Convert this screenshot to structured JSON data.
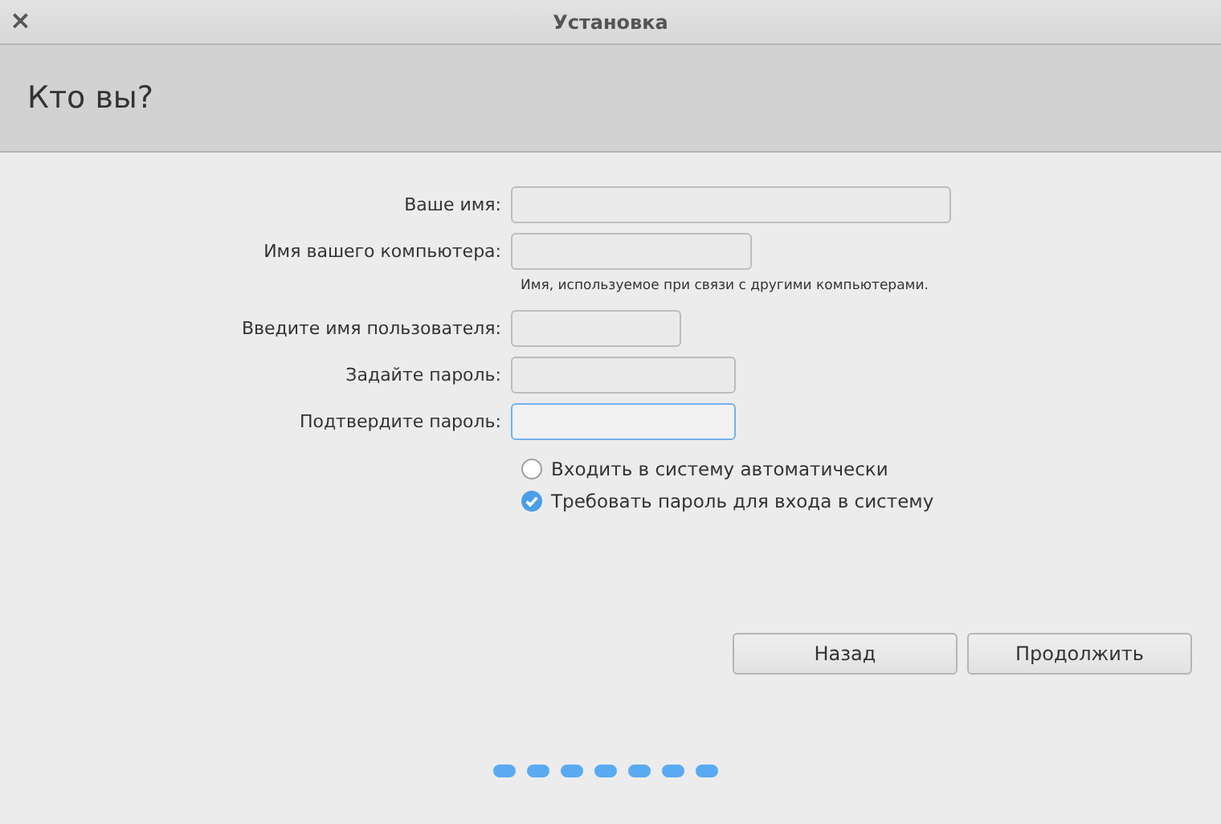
{
  "window": {
    "title": "Установка",
    "close": "×"
  },
  "page_title": "Кто вы?",
  "fields": [
    {
      "label": "Ваше имя:",
      "focused": false
    },
    {
      "label": "Имя вашего компьютера:",
      "focused": false,
      "hint": "Имя, используемое при связи с другими компьютерами."
    },
    {
      "label": "Введите имя пользователя:",
      "focused": false
    },
    {
      "label": "Задайте пароль:",
      "focused": false
    },
    {
      "label": "Подтвердите пароль:",
      "focused": true
    }
  ],
  "login_options": [
    {
      "label": "Входить в систему автоматически",
      "selected": false
    },
    {
      "label": "Требовать пароль для входа в систему",
      "selected": true
    }
  ],
  "buttons": [
    "Назад",
    "Продолжить"
  ]
}
